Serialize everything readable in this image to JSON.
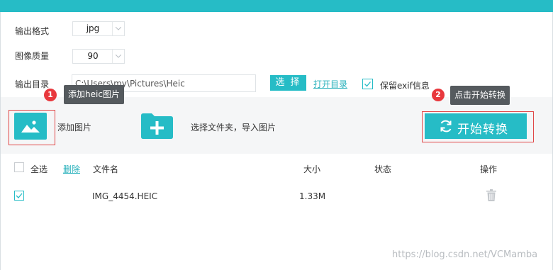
{
  "settings": {
    "format_label": "输出格式",
    "format_value": "jpg",
    "quality_label": "图像质量",
    "quality_value": "90",
    "dir_label": "输出目录",
    "dir_value": "C:\\Users\\my\\Pictures\\Heic",
    "choose_label": "选 择",
    "open_dir_label": "打开目录",
    "exif_label": "保留exif信息",
    "exif_checked": true
  },
  "toolbar": {
    "add_image_label": "添加图片",
    "add_folder_label": "选择文件夹，导入图片",
    "start_label": "开始转换"
  },
  "callouts": [
    {
      "number": "1",
      "text": "添加heic图片"
    },
    {
      "number": "2",
      "text": "点击开始转换"
    }
  ],
  "table": {
    "select_all_label": "全选",
    "delete_label": "删除",
    "columns": [
      "文件名",
      "大小",
      "状态",
      "操作"
    ],
    "rows": [
      {
        "checked": true,
        "filename": "IMG_4454.HEIC",
        "size": "1.33M",
        "status": ""
      }
    ]
  },
  "watermark": "https://blog.csdn.net/VCMamba",
  "colors": {
    "accent": "#26bcc6",
    "highlight_box": "#e04848",
    "badge": "#e8383d",
    "tooltip_bg": "#555a5e"
  },
  "icons": [
    "chevron-down-icon",
    "image-icon",
    "folder-add-icon",
    "refresh-icon",
    "check-icon",
    "trash-icon"
  ]
}
